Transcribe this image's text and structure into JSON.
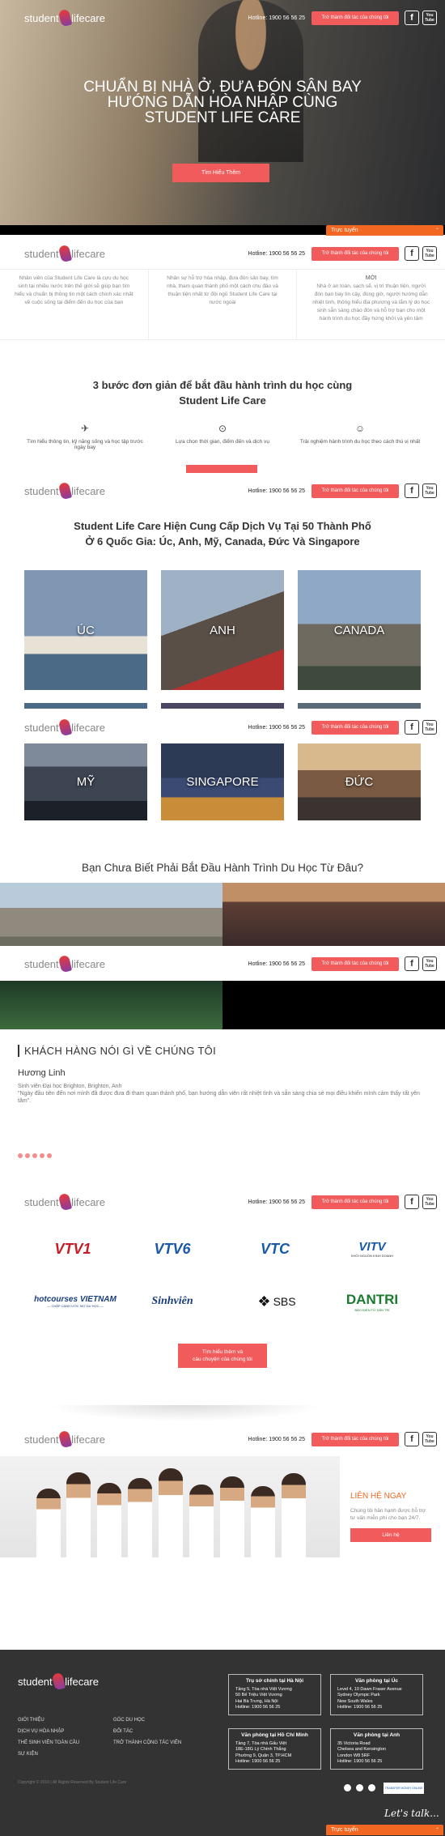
{
  "header": {
    "logo_left": "student",
    "logo_right": "lifecare",
    "hotline": "Hotline: 1900 56 56 25",
    "cta": "Trở thành đối tác của chúng tôi",
    "facebook": "f",
    "youtube_top": "You",
    "youtube_bottom": "Tube"
  },
  "hero": {
    "title": "CHUẨN BỊ NHÀ Ở, ĐƯA ĐÓN SÂN BAY HƯỚNG DẪN HÒA NHẬP CÙNG STUDENT LIFE CARE",
    "button": "Tìm Hiểu Thêm"
  },
  "online_chat": {
    "label": "Trực tuyến",
    "caret": "⌃"
  },
  "features": [
    {
      "title": "",
      "text": "Nhân viên của Student Life Care là cựu du học sinh tại nhiều nước trên thế giới sẽ giúp bạn tìm hiểu và chuẩn bị thông tin một cách chính xác nhất về cuộc sống tại điểm đến du học của bạn"
    },
    {
      "title": "",
      "text": "Nhân sự hỗ trợ hòa nhập, đưa đón sân bay, tìm nhà, tham quan thành phố một cách chu đáo và thuận tiện nhất từ đội ngũ Student Life Care tại nước ngoài"
    },
    {
      "title": "MỚI",
      "text": "Nhà ở an toàn, sạch sẽ, vị trí thuận tiện, người đón bạn bay tin cậy, đúng giờ, người hướng dẫn nhiệt tình, thông hiểu địa phương và lắm lý do học sinh sẵn sàng chào đón và hỗ trợ bạn cho một hành trình du học đầy hứng khởi và yên tâm"
    }
  ],
  "steps": {
    "title_line1": "3 bước đơn giản để bắt đầu hành trình du học cùng",
    "title_line2": "Student Life Care",
    "items": [
      {
        "icon": "paper-plane",
        "glyph": "✈",
        "text": "Tìm hiểu thông tin, kỹ năng sống và học tập trước ngày bay"
      },
      {
        "icon": "map-pin",
        "glyph": "⊙",
        "text": "Lựa chọn thời gian, điểm đến và dịch vụ"
      },
      {
        "icon": "smile",
        "glyph": "☺",
        "text": "Trải nghiệm hành trình du học theo cách thú vị nhất"
      }
    ]
  },
  "destinations": {
    "title_line1": "Student Life Care Hiện Cung Cấp Dịch Vụ Tại 50 Thành Phố",
    "title_line2": "Ở 6 Quốc Gia: Úc, Anh, Mỹ, Canada, Đức Và Singapore",
    "countries": [
      "ÚC",
      "ANH",
      "CANADA",
      "MỸ",
      "SINGAPORE",
      "ĐỨC"
    ]
  },
  "question": "Bạn Chưa Biết Phải Bắt Đầu Hành Trình Du Học Từ Đâu?",
  "testimonial": {
    "heading": "KHÁCH HÀNG NÓI GÌ VỀ CHÚNG TÔI",
    "name": "Hương Linh",
    "school": "Sinh viên Đại học Brighton, Brighton, Anh",
    "quote": "\"Ngày đầu tiên đến nơi mình đã được đưa đi tham quan thành phố, bạn hướng dẫn viên rất nhiệt tình và sẵn sàng chia sẻ mọi điều khiến mình cảm thấy rất yên tâm\"."
  },
  "media": {
    "logos": [
      "VTV1",
      "VTV6",
      "VTC",
      "VITV",
      "hotcourses VIETNAM",
      "Sinhviên",
      "SBS",
      "DANTRI"
    ],
    "vitv_sub": "KHỞI NGUỒN KINH DOANH",
    "hotcourses_sub": "— CHẮP CÁNH ƯỚC MƠ DU HỌC —",
    "dantri_sub": "BÁO ĐIỆN TỬ DÂN TRÍ",
    "button_line1": "Tìm hiểu thêm và",
    "button_line2": "câu chuyện của chúng tôi"
  },
  "contact": {
    "title": "LIÊN HỆ NGAY",
    "text": "Chúng tôi hân hạnh được hỗ trợ tư vấn miễn phí cho bạn 24/7.",
    "button": "Liên hệ"
  },
  "footer": {
    "logo_left": "student",
    "logo_right": "lifecare",
    "links": [
      "GIỚI THIỆU",
      "GÓC DU HỌC",
      "DỊCH VỤ HÒA NHẬP",
      "ĐỐI TÁC",
      "THẺ SINH VIÊN TOÀN CẦU",
      "TRỞ THÀNH CỘNG TÁC VIÊN",
      "SỰ KIỆN"
    ],
    "offices": [
      {
        "title": "Trụ sở chính tại Hà Nội",
        "lines": [
          "Tầng 5, Tòa nhà Việt Vương",
          "50 Bế Triệu Việt Vương",
          "Hai Bà Trưng, Hà Nội",
          "Hotline: 1900 56 56 25"
        ]
      },
      {
        "title": "Văn phòng tại Úc",
        "lines": [
          "Level 4, 10 Dawn Fraser Avenue",
          "Sydney Olympic Park",
          "New South Wales",
          "Hotline: 1900 56 56 25"
        ]
      },
      {
        "title": "Văn phòng tại Hồ Chí Minh",
        "lines": [
          "Tầng 7, Tòa nhà Gấu Việt",
          "18E-18G Lý Chính Thắng",
          "Phường 9, Quận 3, TP.HCM",
          "Hotline: 1900 56 56 25"
        ]
      },
      {
        "title": "Văn phòng tại Anh",
        "lines": [
          "35 Victoria Road",
          "Chelsea and Kensington",
          "London W8 5RF",
          "Hotline: 1900 56 56 25"
        ]
      }
    ],
    "copyright": "Copyright © 2016 | All Rights Reserved By Student Life Care",
    "badge": "TRANSFER MONEY ONLINE",
    "lets_talk": "Let's talk..."
  },
  "colors": {
    "accent": "#f25b5b",
    "chat": "#f26722",
    "footer": "#333333"
  }
}
